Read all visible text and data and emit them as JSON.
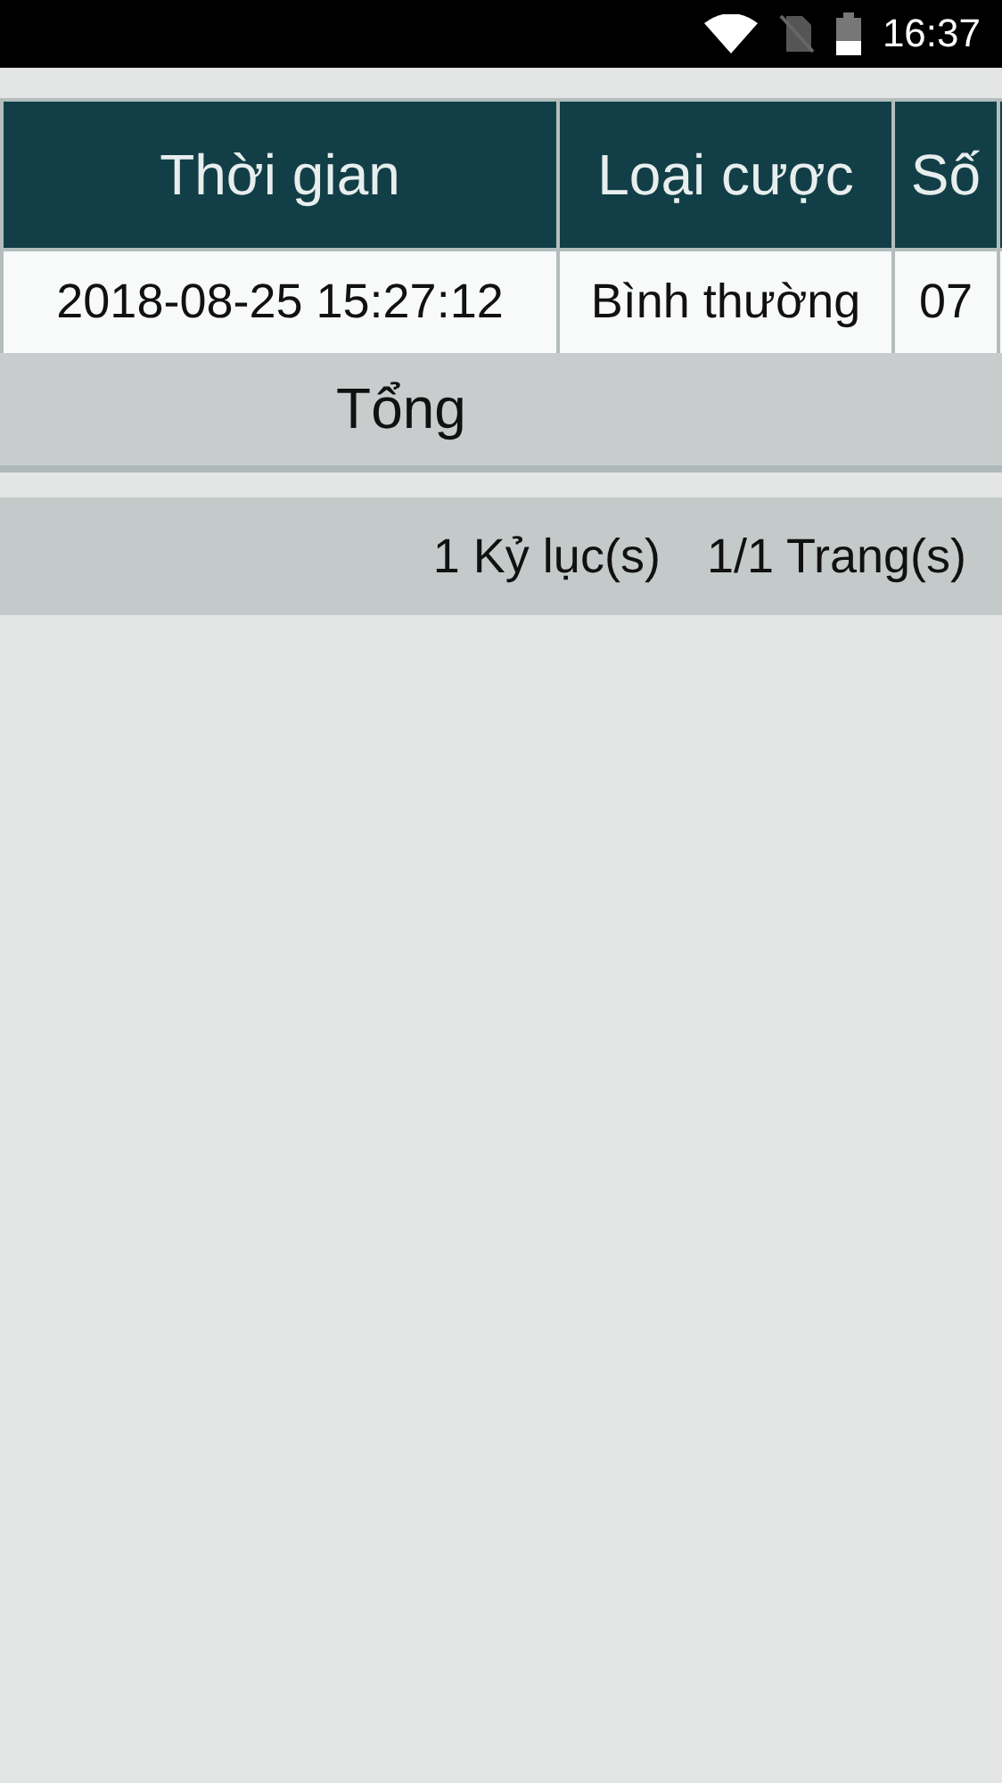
{
  "status_bar": {
    "time": "16:37"
  },
  "table": {
    "columns": [
      "Thời gian",
      "Loại cược",
      "Số",
      ""
    ],
    "rows": [
      [
        "2018-08-25 15:27:12",
        "Bình thường",
        "07",
        ""
      ]
    ],
    "total_label": "Tổng"
  },
  "footer": {
    "records": "1 Kỷ lục(s)",
    "pages": "1/1 Trang(s)"
  }
}
